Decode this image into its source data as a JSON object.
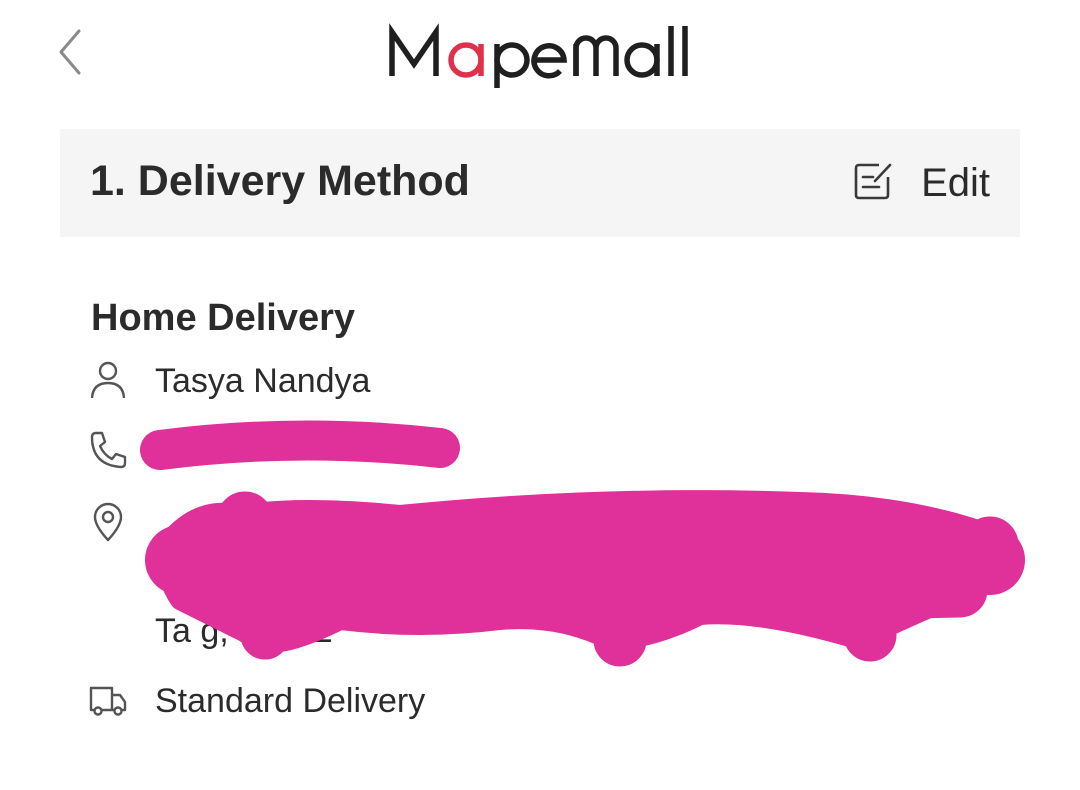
{
  "header": {
    "logo_text": "Mapemall",
    "logo_colors": {
      "dark": "#1f1f1f",
      "accent": "#e0304a"
    }
  },
  "section": {
    "title": "1. Delivery Method",
    "edit_label": "Edit"
  },
  "delivery": {
    "method": "Home Delivery",
    "recipient_name": "Tasya Nandya",
    "address_tail": "Ta          g,             15122",
    "shipping_type": "Standard Delivery"
  },
  "icons": {
    "back": "chevron-left-icon",
    "edit": "edit-note-icon",
    "person": "person-icon",
    "phone": "phone-icon",
    "location": "location-pin-icon",
    "truck": "truck-icon"
  },
  "colors": {
    "redaction": "#e0309a",
    "header_bg": "#f5f5f5",
    "text": "#2b2b2b"
  }
}
